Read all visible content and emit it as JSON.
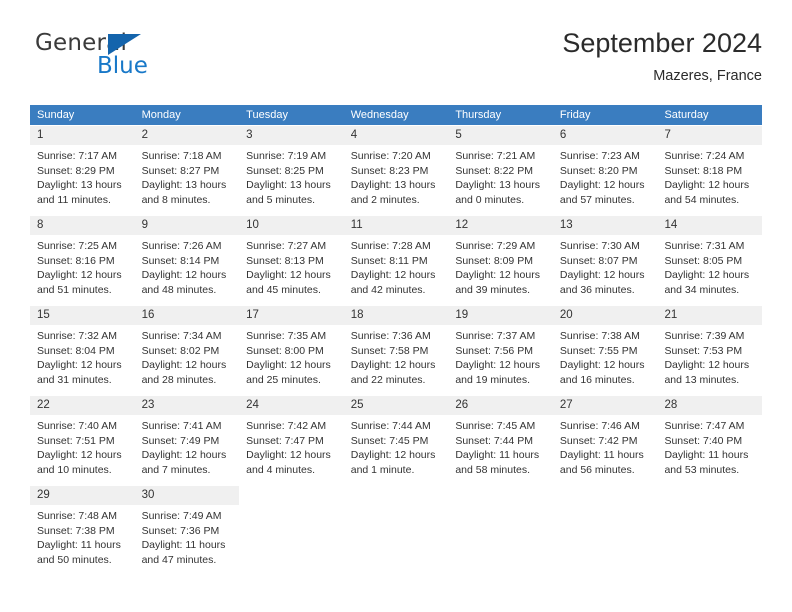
{
  "brand": {
    "name_part1": "General",
    "name_part2": "Blue",
    "flag_color": "#1464ac",
    "blue_color": "#1878c8"
  },
  "header": {
    "title": "September 2024",
    "subtitle": "Mazeres, France"
  },
  "colors": {
    "header_row_bg": "#3a7dc0",
    "daynum_bg": "#f0f0f0",
    "text": "#333333"
  },
  "weekdays": [
    "Sunday",
    "Monday",
    "Tuesday",
    "Wednesday",
    "Thursday",
    "Friday",
    "Saturday"
  ],
  "weeks": [
    [
      {
        "day": "1",
        "sunrise": "Sunrise: 7:17 AM",
        "sunset": "Sunset: 8:29 PM",
        "daylight1": "Daylight: 13 hours",
        "daylight2": "and 11 minutes."
      },
      {
        "day": "2",
        "sunrise": "Sunrise: 7:18 AM",
        "sunset": "Sunset: 8:27 PM",
        "daylight1": "Daylight: 13 hours",
        "daylight2": "and 8 minutes."
      },
      {
        "day": "3",
        "sunrise": "Sunrise: 7:19 AM",
        "sunset": "Sunset: 8:25 PM",
        "daylight1": "Daylight: 13 hours",
        "daylight2": "and 5 minutes."
      },
      {
        "day": "4",
        "sunrise": "Sunrise: 7:20 AM",
        "sunset": "Sunset: 8:23 PM",
        "daylight1": "Daylight: 13 hours",
        "daylight2": "and 2 minutes."
      },
      {
        "day": "5",
        "sunrise": "Sunrise: 7:21 AM",
        "sunset": "Sunset: 8:22 PM",
        "daylight1": "Daylight: 13 hours",
        "daylight2": "and 0 minutes."
      },
      {
        "day": "6",
        "sunrise": "Sunrise: 7:23 AM",
        "sunset": "Sunset: 8:20 PM",
        "daylight1": "Daylight: 12 hours",
        "daylight2": "and 57 minutes."
      },
      {
        "day": "7",
        "sunrise": "Sunrise: 7:24 AM",
        "sunset": "Sunset: 8:18 PM",
        "daylight1": "Daylight: 12 hours",
        "daylight2": "and 54 minutes."
      }
    ],
    [
      {
        "day": "8",
        "sunrise": "Sunrise: 7:25 AM",
        "sunset": "Sunset: 8:16 PM",
        "daylight1": "Daylight: 12 hours",
        "daylight2": "and 51 minutes."
      },
      {
        "day": "9",
        "sunrise": "Sunrise: 7:26 AM",
        "sunset": "Sunset: 8:14 PM",
        "daylight1": "Daylight: 12 hours",
        "daylight2": "and 48 minutes."
      },
      {
        "day": "10",
        "sunrise": "Sunrise: 7:27 AM",
        "sunset": "Sunset: 8:13 PM",
        "daylight1": "Daylight: 12 hours",
        "daylight2": "and 45 minutes."
      },
      {
        "day": "11",
        "sunrise": "Sunrise: 7:28 AM",
        "sunset": "Sunset: 8:11 PM",
        "daylight1": "Daylight: 12 hours",
        "daylight2": "and 42 minutes."
      },
      {
        "day": "12",
        "sunrise": "Sunrise: 7:29 AM",
        "sunset": "Sunset: 8:09 PM",
        "daylight1": "Daylight: 12 hours",
        "daylight2": "and 39 minutes."
      },
      {
        "day": "13",
        "sunrise": "Sunrise: 7:30 AM",
        "sunset": "Sunset: 8:07 PM",
        "daylight1": "Daylight: 12 hours",
        "daylight2": "and 36 minutes."
      },
      {
        "day": "14",
        "sunrise": "Sunrise: 7:31 AM",
        "sunset": "Sunset: 8:05 PM",
        "daylight1": "Daylight: 12 hours",
        "daylight2": "and 34 minutes."
      }
    ],
    [
      {
        "day": "15",
        "sunrise": "Sunrise: 7:32 AM",
        "sunset": "Sunset: 8:04 PM",
        "daylight1": "Daylight: 12 hours",
        "daylight2": "and 31 minutes."
      },
      {
        "day": "16",
        "sunrise": "Sunrise: 7:34 AM",
        "sunset": "Sunset: 8:02 PM",
        "daylight1": "Daylight: 12 hours",
        "daylight2": "and 28 minutes."
      },
      {
        "day": "17",
        "sunrise": "Sunrise: 7:35 AM",
        "sunset": "Sunset: 8:00 PM",
        "daylight1": "Daylight: 12 hours",
        "daylight2": "and 25 minutes."
      },
      {
        "day": "18",
        "sunrise": "Sunrise: 7:36 AM",
        "sunset": "Sunset: 7:58 PM",
        "daylight1": "Daylight: 12 hours",
        "daylight2": "and 22 minutes."
      },
      {
        "day": "19",
        "sunrise": "Sunrise: 7:37 AM",
        "sunset": "Sunset: 7:56 PM",
        "daylight1": "Daylight: 12 hours",
        "daylight2": "and 19 minutes."
      },
      {
        "day": "20",
        "sunrise": "Sunrise: 7:38 AM",
        "sunset": "Sunset: 7:55 PM",
        "daylight1": "Daylight: 12 hours",
        "daylight2": "and 16 minutes."
      },
      {
        "day": "21",
        "sunrise": "Sunrise: 7:39 AM",
        "sunset": "Sunset: 7:53 PM",
        "daylight1": "Daylight: 12 hours",
        "daylight2": "and 13 minutes."
      }
    ],
    [
      {
        "day": "22",
        "sunrise": "Sunrise: 7:40 AM",
        "sunset": "Sunset: 7:51 PM",
        "daylight1": "Daylight: 12 hours",
        "daylight2": "and 10 minutes."
      },
      {
        "day": "23",
        "sunrise": "Sunrise: 7:41 AM",
        "sunset": "Sunset: 7:49 PM",
        "daylight1": "Daylight: 12 hours",
        "daylight2": "and 7 minutes."
      },
      {
        "day": "24",
        "sunrise": "Sunrise: 7:42 AM",
        "sunset": "Sunset: 7:47 PM",
        "daylight1": "Daylight: 12 hours",
        "daylight2": "and 4 minutes."
      },
      {
        "day": "25",
        "sunrise": "Sunrise: 7:44 AM",
        "sunset": "Sunset: 7:45 PM",
        "daylight1": "Daylight: 12 hours",
        "daylight2": "and 1 minute."
      },
      {
        "day": "26",
        "sunrise": "Sunrise: 7:45 AM",
        "sunset": "Sunset: 7:44 PM",
        "daylight1": "Daylight: 11 hours",
        "daylight2": "and 58 minutes."
      },
      {
        "day": "27",
        "sunrise": "Sunrise: 7:46 AM",
        "sunset": "Sunset: 7:42 PM",
        "daylight1": "Daylight: 11 hours",
        "daylight2": "and 56 minutes."
      },
      {
        "day": "28",
        "sunrise": "Sunrise: 7:47 AM",
        "sunset": "Sunset: 7:40 PM",
        "daylight1": "Daylight: 11 hours",
        "daylight2": "and 53 minutes."
      }
    ],
    [
      {
        "day": "29",
        "sunrise": "Sunrise: 7:48 AM",
        "sunset": "Sunset: 7:38 PM",
        "daylight1": "Daylight: 11 hours",
        "daylight2": "and 50 minutes."
      },
      {
        "day": "30",
        "sunrise": "Sunrise: 7:49 AM",
        "sunset": "Sunset: 7:36 PM",
        "daylight1": "Daylight: 11 hours",
        "daylight2": "and 47 minutes."
      },
      {
        "day": "",
        "sunrise": "",
        "sunset": "",
        "daylight1": "",
        "daylight2": ""
      },
      {
        "day": "",
        "sunrise": "",
        "sunset": "",
        "daylight1": "",
        "daylight2": ""
      },
      {
        "day": "",
        "sunrise": "",
        "sunset": "",
        "daylight1": "",
        "daylight2": ""
      },
      {
        "day": "",
        "sunrise": "",
        "sunset": "",
        "daylight1": "",
        "daylight2": ""
      },
      {
        "day": "",
        "sunrise": "",
        "sunset": "",
        "daylight1": "",
        "daylight2": ""
      }
    ]
  ]
}
